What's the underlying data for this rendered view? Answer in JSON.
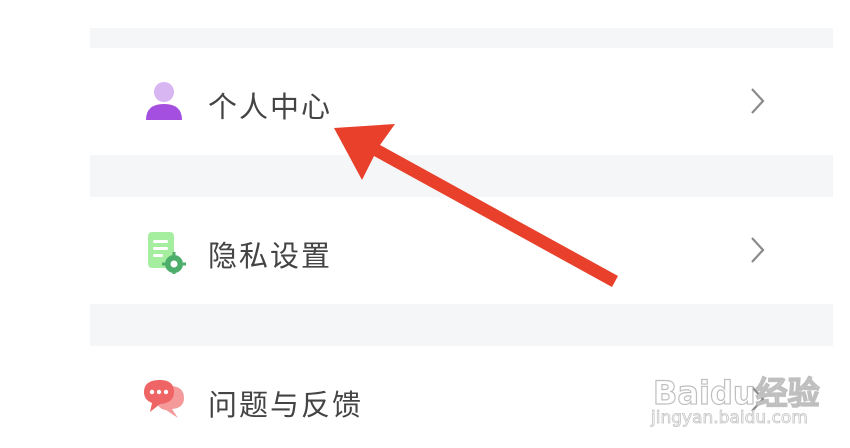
{
  "settings_list": {
    "items": [
      {
        "label": "个人中心",
        "icon": "person-icon"
      },
      {
        "label": "隐私设置",
        "icon": "document-gear-icon"
      },
      {
        "label": "问题与反馈",
        "icon": "chat-bubble-icon"
      }
    ]
  },
  "watermark": {
    "brand": "Baidu经验",
    "url": "jingyan.baidu.com"
  },
  "colors": {
    "band": "#f5f6f8",
    "arrow": "#e8402a",
    "person_icon": "#a54fe0",
    "privacy_icon": "#8ee08a",
    "feedback_icon": "#f06a6a"
  }
}
